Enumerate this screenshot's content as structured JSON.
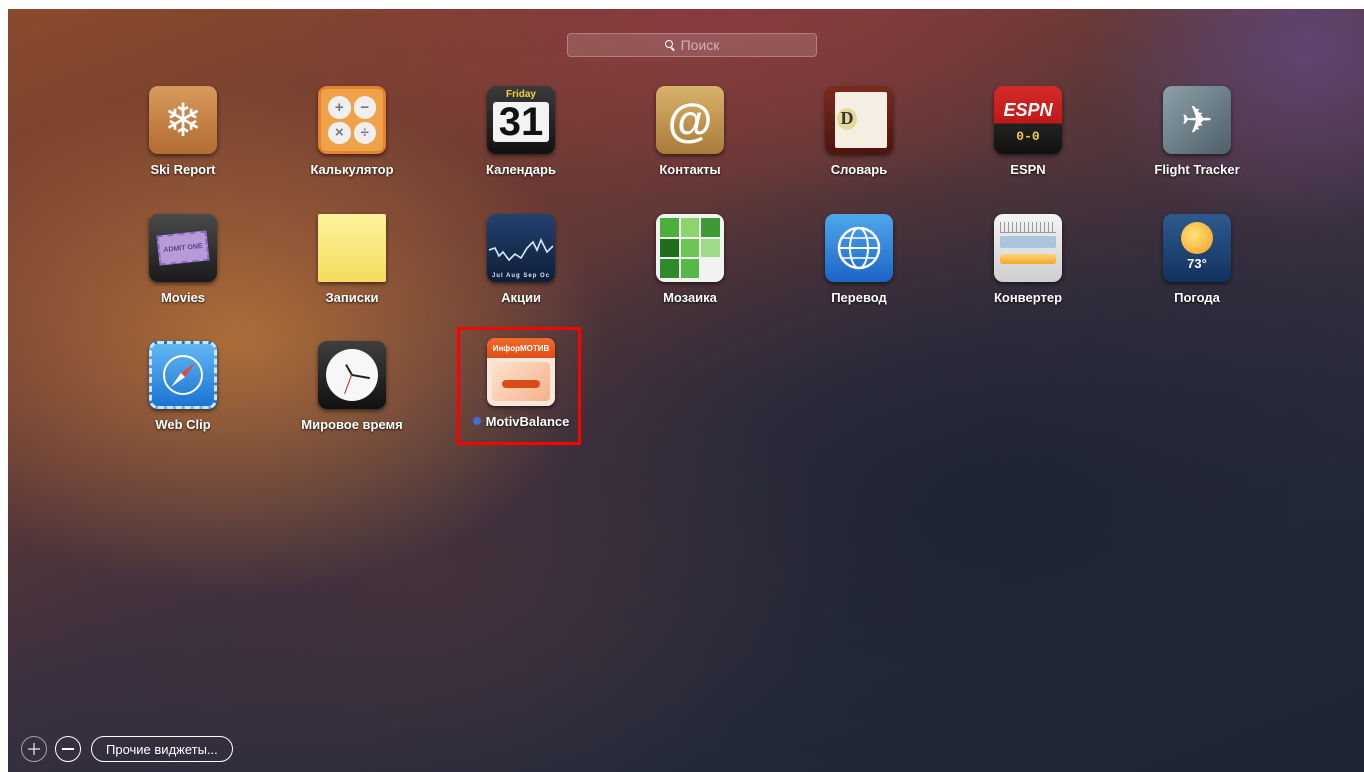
{
  "search": {
    "placeholder": "Поиск"
  },
  "widgets": [
    {
      "label": "Ski Report",
      "icon": "ski-report-icon"
    },
    {
      "label": "Калькулятор",
      "icon": "calculator-icon"
    },
    {
      "label": "Календарь",
      "icon": "calendar-icon",
      "month_text": "Friday",
      "day_text": "31"
    },
    {
      "label": "Контакты",
      "icon": "contacts-icon"
    },
    {
      "label": "Словарь",
      "icon": "dictionary-icon"
    },
    {
      "label": "ESPN",
      "icon": "espn-icon",
      "logo_text": "ESPN",
      "score_text": "0-0"
    },
    {
      "label": "Flight Tracker",
      "icon": "flight-tracker-icon"
    },
    {
      "label": "Movies",
      "icon": "movies-icon",
      "ticket_text": "ADMIT ONE"
    },
    {
      "label": "Записки",
      "icon": "stickies-icon"
    },
    {
      "label": "Акции",
      "icon": "stocks-icon",
      "axis_text": "Jul Aug Sep Oc"
    },
    {
      "label": "Мозаика",
      "icon": "tile-game-icon"
    },
    {
      "label": "Перевод",
      "icon": "translation-icon"
    },
    {
      "label": "Конвертер",
      "icon": "unit-converter-icon"
    },
    {
      "label": "Погода",
      "icon": "weather-icon",
      "temp_text": "73°"
    },
    {
      "label": "Web Clip",
      "icon": "web-clip-icon"
    },
    {
      "label": "Мировое время",
      "icon": "world-clock-icon"
    },
    {
      "label": "MotivBalance",
      "icon": "motivbalance-icon",
      "banner_text": "ИнфорМОТИВ",
      "new": true
    }
  ],
  "bottom": {
    "more_widgets_label": "Прочие виджеты..."
  },
  "colors": {
    "highlight": "#ff0000",
    "new_dot": "#3f6ed6"
  }
}
